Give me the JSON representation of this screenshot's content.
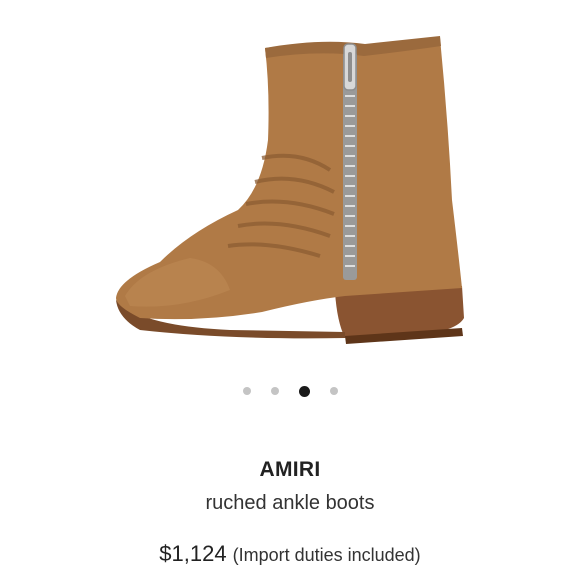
{
  "product": {
    "brand": "AMIRI",
    "name": "ruched ankle boots",
    "price": "$1,124",
    "duties_note": "(Import duties included)"
  },
  "gallery": {
    "image_count": 4,
    "active_index": 2,
    "image_subject": "boot-photo"
  },
  "colors": {
    "suede": "#b07a46",
    "heel": "#8a5431",
    "zipper": "#c9c9c9",
    "dot_active": "#1a1a1a",
    "dot_inactive": "#c4c4c4"
  }
}
